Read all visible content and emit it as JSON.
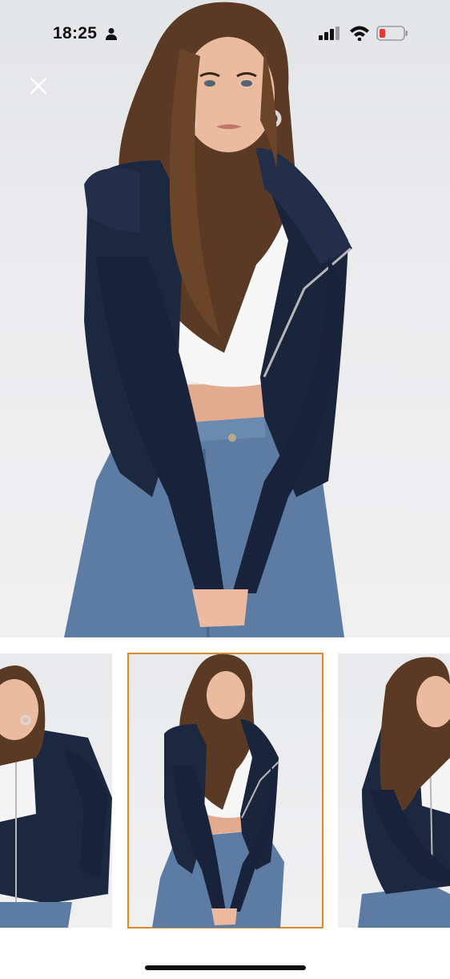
{
  "status_bar": {
    "time": "18:25",
    "icons": [
      "person-icon",
      "cellular-signal-icon",
      "wifi-icon",
      "battery-low-icon"
    ],
    "battery_color": "#e53935"
  },
  "viewer": {
    "close_icon": "close-icon",
    "main_image": {
      "subject": "model-wearing-navy-zip-cardigan"
    },
    "thumbnails": [
      {
        "id": "thumb-1",
        "selected": false
      },
      {
        "id": "thumb-2",
        "selected": true
      },
      {
        "id": "thumb-3",
        "selected": false
      }
    ],
    "selected_border_color": "#e08a2e"
  },
  "colors": {
    "cardigan": "#1c2740",
    "jeans": "#5d7ca3",
    "top": "#f6f6f6",
    "hair": "#5a3a24",
    "skin": "#e8b69a"
  }
}
